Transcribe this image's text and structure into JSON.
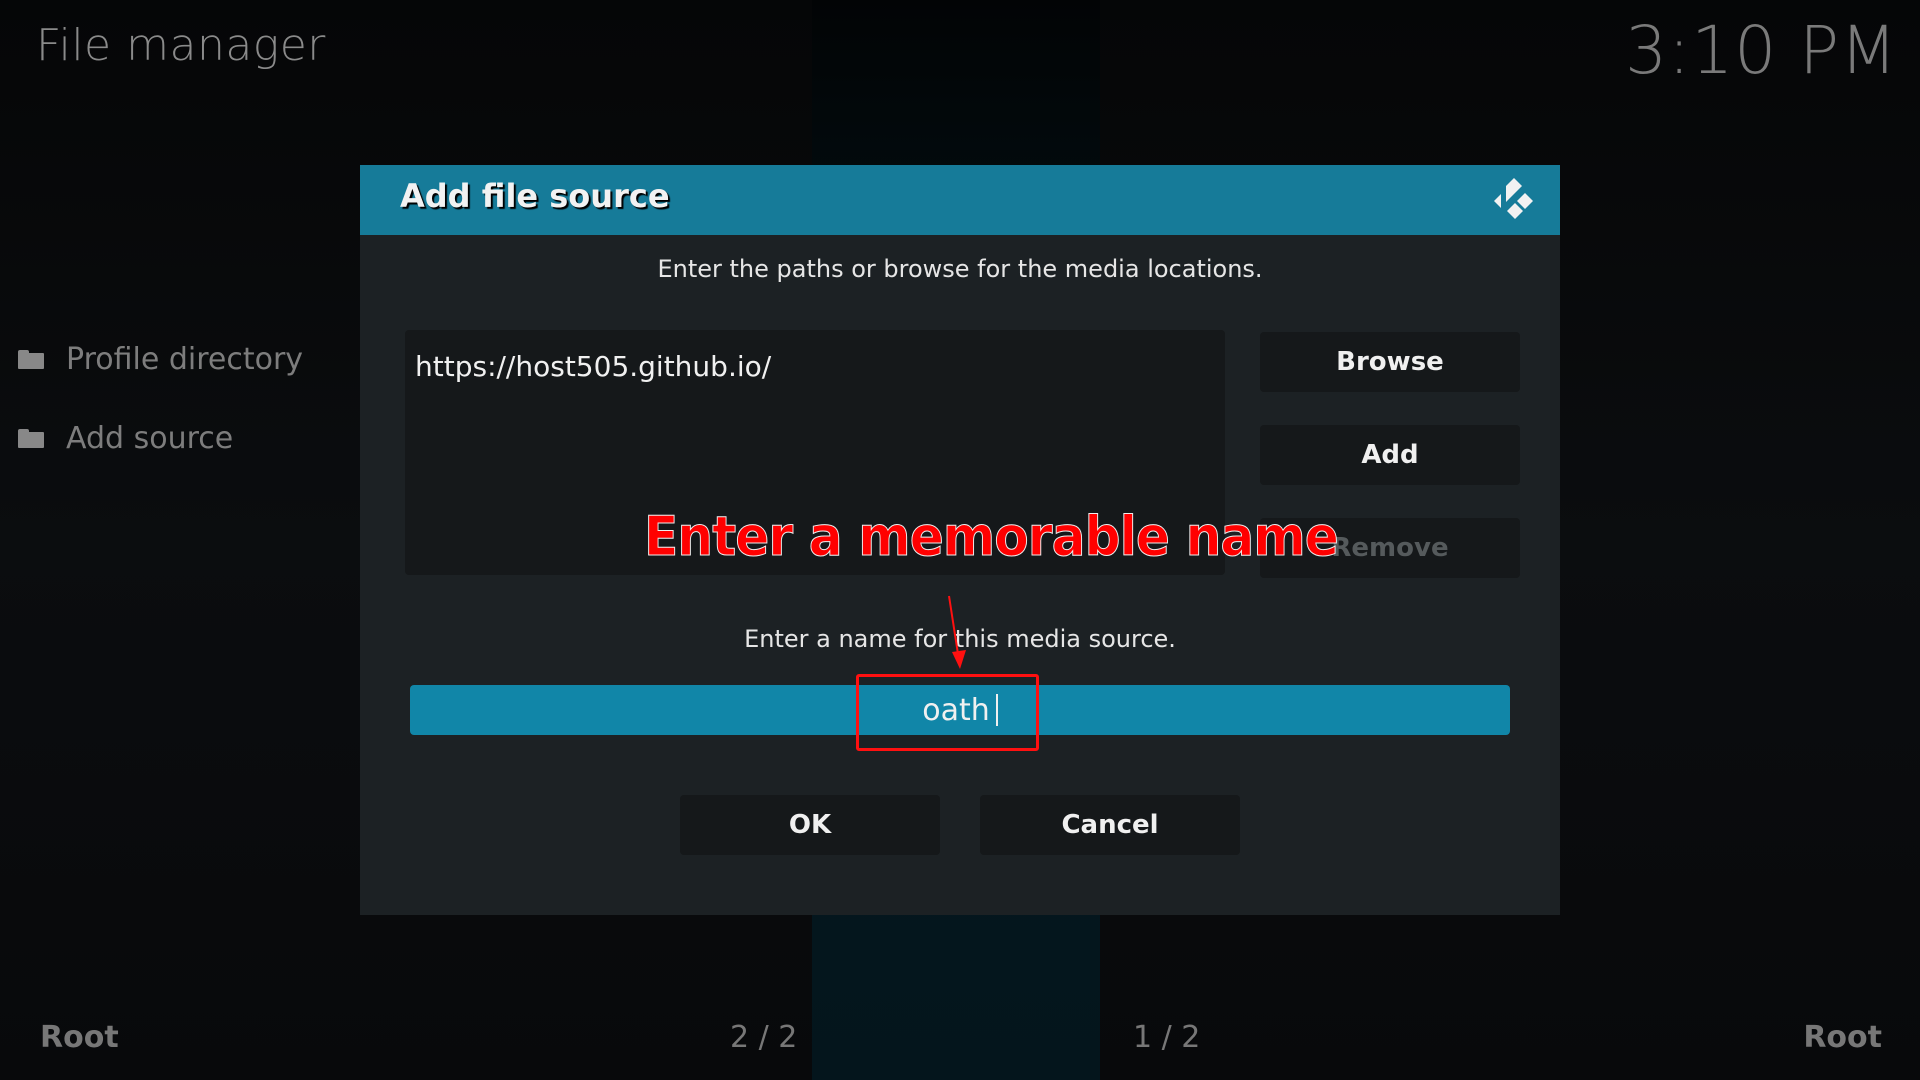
{
  "app": {
    "window_title": "File manager",
    "clock": "3:10 PM"
  },
  "sidebar": {
    "items": [
      {
        "label": "Profile directory",
        "icon": "folder-icon"
      },
      {
        "label": "Add source",
        "icon": "folder-icon"
      }
    ]
  },
  "footer": {
    "left_path": "Root",
    "left_page": "2 / 2",
    "right_page": "1 / 2",
    "right_path": "Root"
  },
  "dialog": {
    "title": "Add file source",
    "logo_icon": "kodi-logo-icon",
    "paths_prompt": "Enter the paths or browse for the media locations.",
    "paths": [
      "https://host505.github.io/"
    ],
    "buttons": {
      "browse": "Browse",
      "add": "Add",
      "remove": "Remove"
    },
    "name_prompt": "Enter a name for this media source.",
    "name_value": "oath",
    "ok": "OK",
    "cancel": "Cancel"
  },
  "annotation": {
    "text": "Enter a memorable name",
    "color": "#ff0000"
  },
  "colors": {
    "accent": "#167b99",
    "input_focus": "#1186a8",
    "dialog_bg": "#1c2124"
  }
}
